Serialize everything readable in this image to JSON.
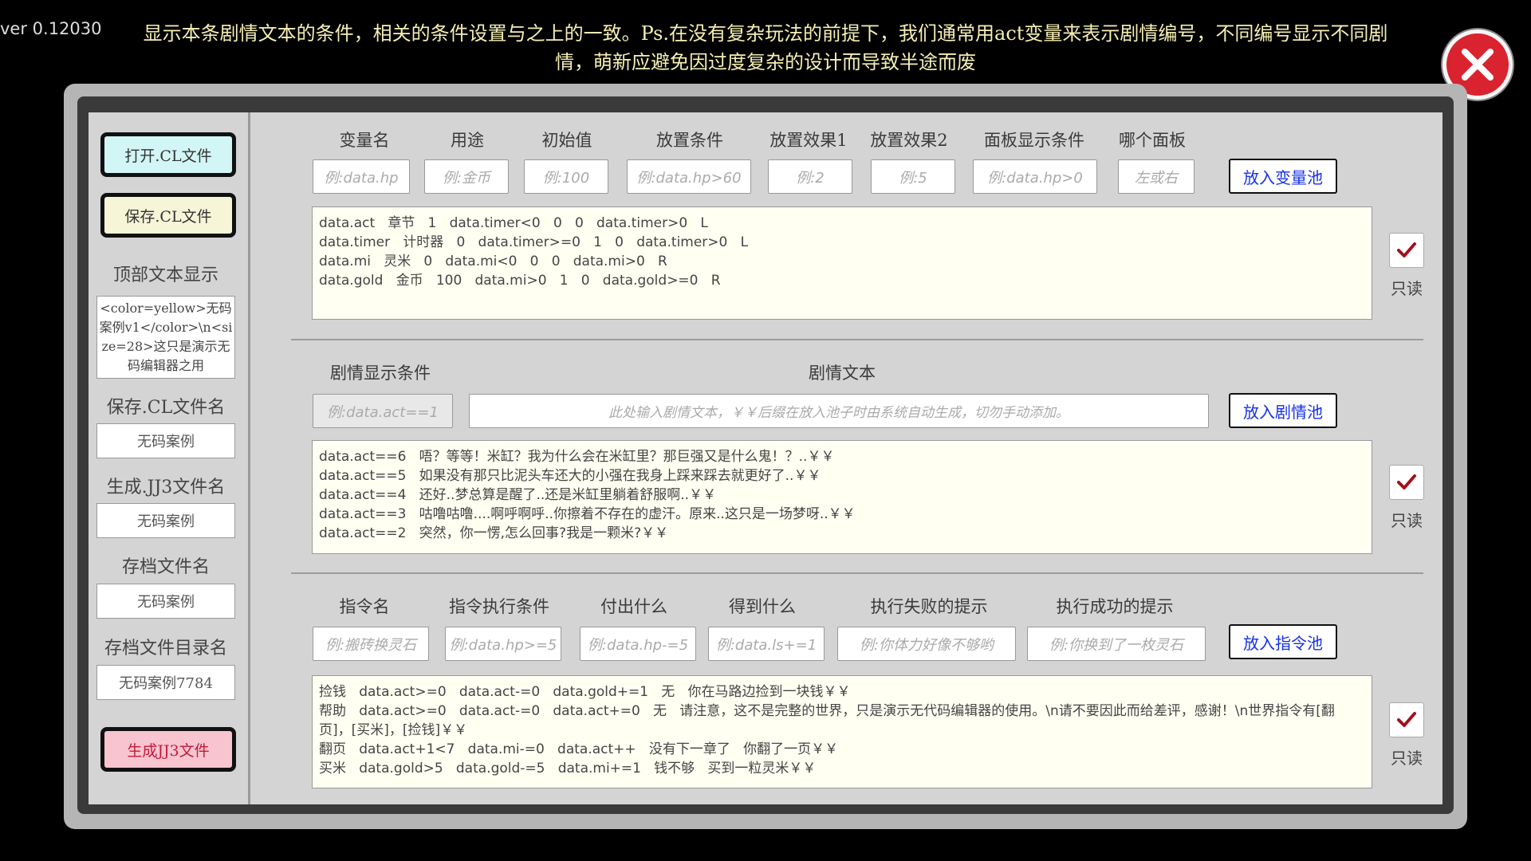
{
  "version": "ver 0.12030",
  "hint_text": "显示本条剧情文本的条件，相关的条件设置与之上的一致。Ps.在没有复杂玩法的前提下，我们通常用act变量来表示剧情编号，不同编号显示不同剧情，萌新应避免因过度复杂的设计而导致半途而废",
  "colors": {
    "close_red": "#d9232f",
    "open_btn": "#d2f5f5",
    "save_btn": "#f7f5d8",
    "gen_btn": "#f7c4cf",
    "pool_text": "#1530e8",
    "list_bg": "#fffff2",
    "hint_text": "#f6efb4"
  },
  "icons": {
    "close": "close-x-icon",
    "check": "checkmark-icon"
  },
  "sidebar": {
    "open_btn": "打开.CL文件",
    "save_btn": "保存.CL文件",
    "top_text_label": "顶部文本显示",
    "top_text_value": "<color=yellow>无码案例v1</color>\\n<size=28>这只是演示无码编辑器之用",
    "save_name_label": "保存.CL文件名",
    "save_name_value": "无码案例",
    "gen_name_label": "生成.JJ3文件名",
    "gen_name_value": "无码案例",
    "archive_label": "存档文件名",
    "archive_value": "无码案例",
    "archive_dir_label": "存档文件目录名",
    "archive_dir_value": "无码案例7784",
    "gen_btn": "生成JJ3文件"
  },
  "variables": {
    "headers": [
      "变量名",
      "用途",
      "初始值",
      "放置条件",
      "放置效果1",
      "放置效果2",
      "面板显示条件",
      "哪个面板"
    ],
    "placeholders": [
      "例:data.hp",
      "例:金币",
      "例:100",
      "例:data.hp>60",
      "例:2",
      "例:5",
      "例:data.hp>0",
      "左或右"
    ],
    "button": "放入变量池",
    "rows": [
      "data.act   章节   1   data.timer<0   0   0   data.timer>0   L",
      "data.timer   计时器   0   data.timer>=0   1   0   data.timer>0   L",
      "data.mi   灵米   0   data.mi<0   0   0   data.mi>0   R",
      "data.gold   金币   100   data.mi>0   1   0   data.gold>=0   R"
    ],
    "readonly_label": "只读"
  },
  "story": {
    "headers": [
      "剧情显示条件",
      "剧情文本"
    ],
    "placeholders": [
      "例:data.act==1",
      "此处输入剧情文本，￥￥后缀在放入池子时由系统自动生成，切勿手动添加。"
    ],
    "button": "放入剧情池",
    "rows": [
      "data.act==6   唔？等等！米缸？我为什么会在米缸里？那巨强又是什么鬼！？..￥￥",
      "data.act==5   如果没有那只比泥头车还大的小强在我身上踩来踩去就更好了..￥￥",
      "data.act==4   还好..梦总算是醒了..还是米缸里躺着舒服啊..￥￥",
      "data.act==3   咕噜咕噜....啊呼啊呼..你擦着不存在的虚汗。原来..这只是一场梦呀..￥￥",
      "data.act==2   突然，你一愣,怎么回事?我是一颗米?￥￥"
    ],
    "readonly_label": "只读"
  },
  "commands": {
    "headers": [
      "指令名",
      "指令执行条件",
      "付出什么",
      "得到什么",
      "执行失败的提示",
      "执行成功的提示"
    ],
    "placeholders": [
      "例:搬砖换灵石",
      "例:data.hp>=5",
      "例:data.hp-=5",
      "例:data.ls+=1",
      "例:你体力好像不够哟",
      "例:你换到了一枚灵石"
    ],
    "button": "放入指令池",
    "rows": [
      "捡钱   data.act>=0   data.act-=0   data.gold+=1   无   你在马路边捡到一块钱￥￥",
      "帮助   data.act>=0   data.act-=0   data.act+=0   无   请注意，这不是完整的世界，只是演示无代码编辑器的使用。\\n请不要因此而给差评，感谢！\\n世界指令有[翻页]，[买米]，[捡钱]￥￥",
      "翻页   data.act+1<7   data.mi-=0   data.act++   没有下一章了   你翻了一页￥￥",
      "买米   data.gold>5   data.gold-=5   data.mi+=1   钱不够   买到一粒灵米￥￥"
    ],
    "readonly_label": "只读"
  }
}
